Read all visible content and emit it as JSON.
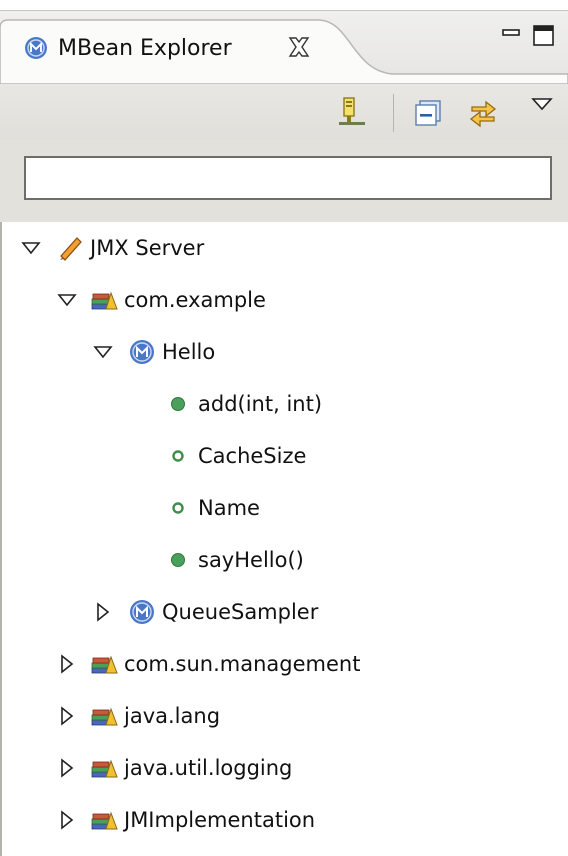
{
  "view": {
    "title": "MBean Explorer",
    "tab_icon": "mbean-icon",
    "close_icon": "close-x-icon",
    "minimize_icon": "minimize-icon",
    "maximize_icon": "maximize-icon"
  },
  "toolbar": {
    "items": [
      "new-connection-icon",
      "collapse-all-icon",
      "link-with-editor-icon",
      "view-menu-chevron-icon"
    ]
  },
  "filter": {
    "value": "",
    "placeholder": ""
  },
  "tree": {
    "nodes": [
      {
        "label": "JMX Server",
        "icon": "server-pencil-icon",
        "expanded": true
      },
      {
        "label": "com.example",
        "icon": "package-books-icon",
        "expanded": true
      },
      {
        "label": "Hello",
        "icon": "mbean-icon",
        "expanded": true
      },
      {
        "label": "add(int, int)",
        "icon": "operation-dot-icon"
      },
      {
        "label": "CacheSize",
        "icon": "attribute-ring-icon"
      },
      {
        "label": "Name",
        "icon": "attribute-ring-icon"
      },
      {
        "label": "sayHello()",
        "icon": "operation-dot-icon"
      },
      {
        "label": "QueueSampler",
        "icon": "mbean-icon",
        "expanded": false
      },
      {
        "label": "com.sun.management",
        "icon": "package-books-icon",
        "expanded": false
      },
      {
        "label": "java.lang",
        "icon": "package-books-icon",
        "expanded": false
      },
      {
        "label": "java.util.logging",
        "icon": "package-books-icon",
        "expanded": false
      },
      {
        "label": "JMImplementation",
        "icon": "package-books-icon",
        "expanded": false
      }
    ]
  },
  "colors": {
    "mbean_blue": "#4a78c8",
    "operation_green": "#4aa05a",
    "attribute_green": "#3f8d4c",
    "chrome": "#e3e1dc"
  }
}
